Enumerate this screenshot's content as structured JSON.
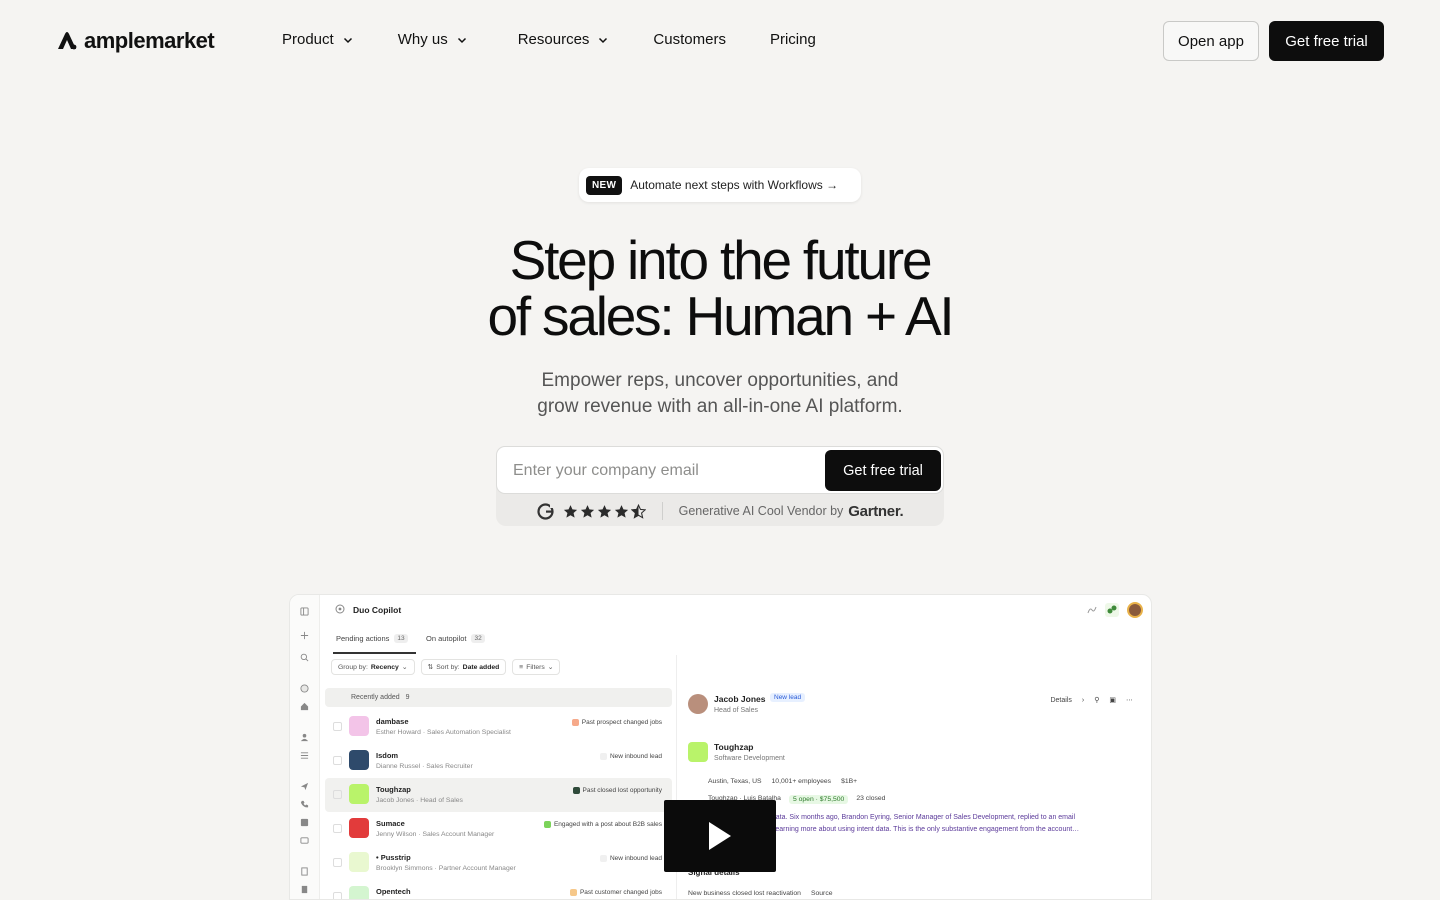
{
  "nav": {
    "logo_text": "amplemarket",
    "links": [
      {
        "label": "Product",
        "has_dropdown": true
      },
      {
        "label": "Why us",
        "has_dropdown": true
      },
      {
        "label": "Resources",
        "has_dropdown": true
      },
      {
        "label": "Customers",
        "has_dropdown": false
      },
      {
        "label": "Pricing",
        "has_dropdown": false
      }
    ],
    "open_app_label": "Open app",
    "trial_label": "Get free trial"
  },
  "hero": {
    "badge_tag": "NEW",
    "badge_text": "Automate next steps with Workflows →",
    "headline_line1": "Step into the future",
    "headline_line2": "of sales: Human + AI",
    "subtitle_line1": "Empower reps, uncover opportunities, and",
    "subtitle_line2": "grow revenue with an all-in-one AI platform.",
    "email_placeholder": "Enter your company email",
    "cta_label": "Get free trial",
    "rating_stars": 4.5,
    "vendor_text": "Generative AI Cool Vendor by",
    "vendor_brand": "Gartner."
  },
  "preview": {
    "title": "Duo Copilot",
    "tabs": [
      {
        "label": "Pending actions",
        "count": "13"
      },
      {
        "label": "On autopilot",
        "count": "32"
      }
    ],
    "filters": {
      "group_prefix": "Group by:",
      "group_value": "Recency",
      "sort_prefix": "Sort by:",
      "sort_value": "Date added",
      "filters_label": "Filters"
    },
    "group_label": "Recently added",
    "group_count": "9",
    "rows": [
      {
        "name": "dambase",
        "sub": "Esther Howard · Sales Automation Specialist",
        "tag": "Past prospect changed jobs",
        "tag_color": "#f6a98a",
        "logo_color": "#f3c4e8"
      },
      {
        "name": "Isdom",
        "sub": "Dianne Russel · Sales Recruiter",
        "tag": "New inbound lead",
        "tag_color": "#f0f0f0",
        "logo_color": "#2e4a6b"
      },
      {
        "name": "Toughzap",
        "sub": "Jacob Jones · Head of Sales",
        "tag": "Past closed lost opportunity",
        "tag_color": "#2f4a3a",
        "logo_color": "#b9f36a"
      },
      {
        "name": "Sumace",
        "sub": "Jenny Wilson · Sales Account Manager",
        "tag": "Engaged with a post about B2B sales",
        "tag_color": "#7bd35a",
        "logo_color": "#e23b3b"
      },
      {
        "name": "• Pusstrip",
        "sub": "Brooklyn Simmons · Partner Account Manager",
        "tag": "New inbound lead",
        "tag_color": "#f0f0f0",
        "logo_color": "#e9f8d0"
      },
      {
        "name": "Opentech",
        "sub": "",
        "tag": "Past customer changed jobs",
        "tag_color": "#f6c88a",
        "logo_color": "#d4f5d0"
      }
    ],
    "detail": {
      "person_name": "Jacob Jones",
      "lead_badge": "New lead",
      "person_role": "Head of Sales",
      "details_label": "Details",
      "company_name": "Toughzap",
      "company_sub": "Software Development",
      "location": "Austin, Texas, US",
      "employees": "10,001+ employees",
      "revenue": "$1B+",
      "owner": "Toughzap · Luis Batalha",
      "open_deals": "5 open · $75,500",
      "closed_deals": "23 closed",
      "insight_line1": "t data. Six months ago, Brandon Eyring, Senior Manager of Sales Development, replied to an email",
      "insight_line2": "n learning more about using intent data. This is the only substantive engagement from the account…",
      "signal_title": "Signal details",
      "signal_item": "New business closed lost reactivation",
      "source_label": "Source"
    }
  }
}
